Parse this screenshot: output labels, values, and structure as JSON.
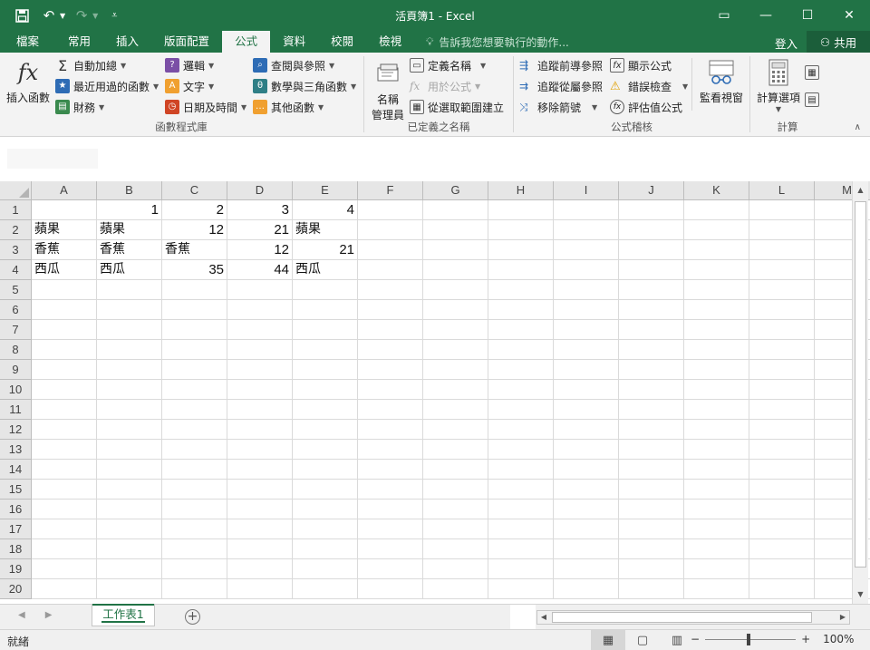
{
  "window": {
    "title": "活頁簿1 - Excel",
    "qat": {
      "save_icon": "save-icon",
      "undo_icon": "undo-icon",
      "redo_icon": "redo-icon",
      "customize_icon": "customize-qat-icon"
    },
    "controls": {
      "ribbon_display": "▭",
      "minimize": "—",
      "maximize": "☐",
      "close": "✕"
    }
  },
  "tabs": [
    "檔案",
    "常用",
    "插入",
    "版面配置",
    "公式",
    "資料",
    "校閱",
    "檢視"
  ],
  "active_tab": "公式",
  "tellme": "告訴我您想要執行的動作...",
  "signin": "登入",
  "share": "共用",
  "ribbon": {
    "function_library": {
      "label": "函數程式庫",
      "insert_function": "插入函數",
      "autosum": "自動加總",
      "recent": "最近用過的函數",
      "financial": "財務",
      "logical": "邏輯",
      "text": "文字",
      "datetime": "日期及時間",
      "lookup": "查閱與參照",
      "math": "數學與三角函數",
      "more": "其他函數"
    },
    "defined_names": {
      "label": "已定義之名稱",
      "name_manager_line1": "名稱",
      "name_manager_line2": "管理員",
      "define_name": "定義名稱",
      "use_in_formula": "用於公式",
      "create_from_selection": "從選取範圍建立"
    },
    "formula_auditing": {
      "label": "公式稽核",
      "trace_precedents": "追蹤前導參照",
      "trace_dependents": "追蹤從屬參照",
      "remove_arrows": "移除箭號",
      "show_formulas": "顯示公式",
      "error_checking": "錯誤檢查",
      "evaluate_formula": "評估值公式",
      "watch_window": "監看視窗"
    },
    "calculation": {
      "label": "計算",
      "options": "計算選項"
    }
  },
  "grid": {
    "columns": [
      "A",
      "B",
      "C",
      "D",
      "E",
      "F",
      "G",
      "H",
      "I",
      "J",
      "K",
      "L",
      "M"
    ],
    "rows": [
      "1",
      "2",
      "3",
      "4",
      "5",
      "6",
      "7",
      "8",
      "9",
      "10",
      "11",
      "12",
      "13",
      "14",
      "15",
      "16",
      "17",
      "18",
      "19",
      "20"
    ],
    "cells": [
      [
        "",
        "1",
        "2",
        "3",
        "4"
      ],
      [
        "蘋果",
        "蘋果",
        "12",
        "21",
        "蘋果"
      ],
      [
        "香蕉",
        "香蕉",
        "香蕉",
        "12",
        "21"
      ],
      [
        "西瓜",
        "西瓜",
        "35",
        "44",
        "西瓜"
      ]
    ]
  },
  "sheet_tab": "工作表1",
  "status": "就緒",
  "zoom": "100%"
}
